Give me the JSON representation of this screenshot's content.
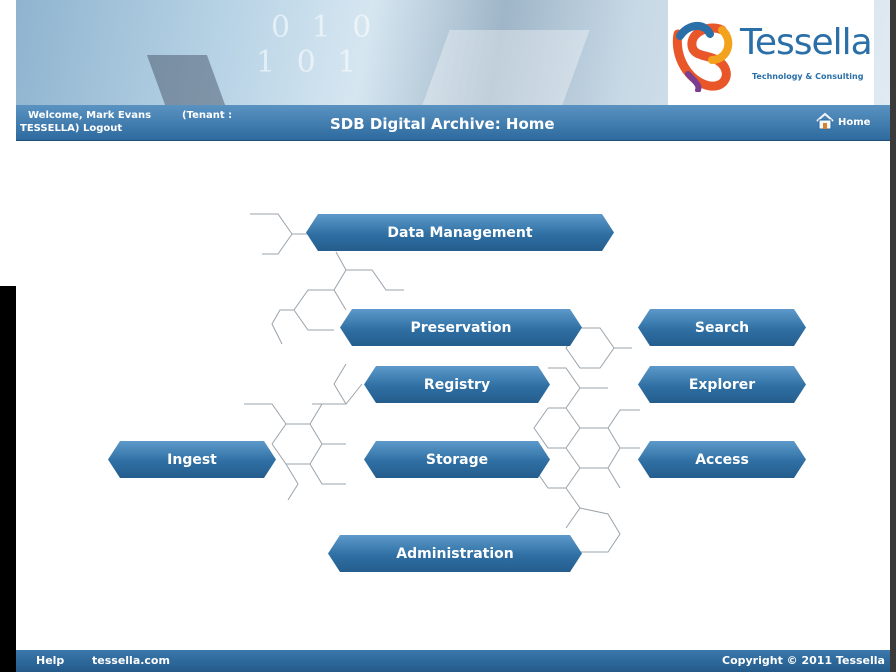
{
  "header": {
    "welcome": "Welcome, Mark Evans",
    "tenant_prefix": "(Tenant :",
    "tenant_name": "TESSELLA)",
    "logout": "Logout",
    "title": "SDB Digital Archive: Home",
    "home": "Home"
  },
  "logo": {
    "name": "Tessella",
    "tagline": "Technology & Consulting"
  },
  "nav": {
    "data_management": "Data Management",
    "preservation": "Preservation",
    "registry": "Registry",
    "storage": "Storage",
    "ingest": "Ingest",
    "administration": "Administration",
    "search": "Search",
    "explorer": "Explorer",
    "access": "Access"
  },
  "footer": {
    "help": "Help",
    "site": "tessella.com",
    "copyright": "Copyright © 2011 Tessella"
  },
  "colors": {
    "header_bar": "#2e6a9e",
    "button": "#2f6fa3",
    "logo_blue": "#2b6fa8"
  }
}
